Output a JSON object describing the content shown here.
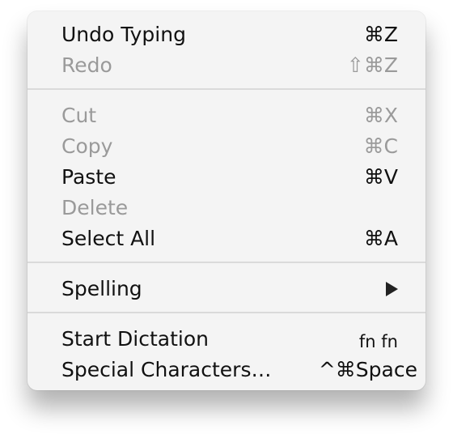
{
  "menu": {
    "items": [
      {
        "label": "Undo Typing",
        "shortcut": "⌘Z"
      },
      {
        "label": "Redo",
        "shortcut": "⇧⌘Z"
      },
      {
        "label": "Cut",
        "shortcut": "⌘X"
      },
      {
        "label": "Copy",
        "shortcut": "⌘C"
      },
      {
        "label": "Paste",
        "shortcut": "⌘V"
      },
      {
        "label": "Delete",
        "shortcut": ""
      },
      {
        "label": "Select All",
        "shortcut": "⌘A"
      },
      {
        "label": "Spelling",
        "icon": "submenu-arrow-icon"
      },
      {
        "label": "Start Dictation",
        "shortcut": "fn fn"
      },
      {
        "label": "Special Characters…",
        "shortcut": "^⌘Space"
      }
    ]
  },
  "colors": {
    "enabled_text": "#111111",
    "disabled_text": "#9a9a9a",
    "separator": "#dadada",
    "menu_background": "#f4f4f4"
  }
}
